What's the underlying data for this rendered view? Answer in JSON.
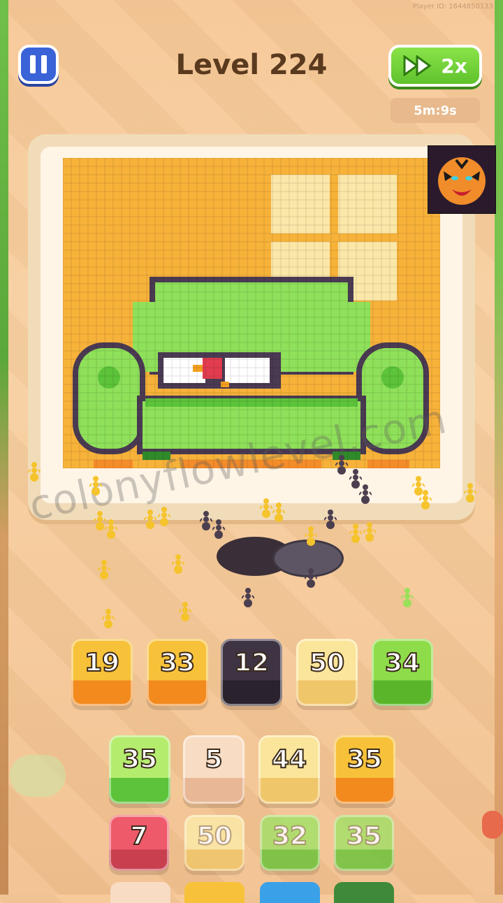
{
  "header": {
    "player_id": "Player ID: 1644850133",
    "level_title": "Level 224",
    "speed_label": "2x",
    "timer": "5m:9s"
  },
  "watermark": "colonyflowlevel.com",
  "colors": {
    "wall": "#f7b23a",
    "window": "#fbe7a8",
    "sofa_light": "#8fe05a",
    "sofa_mid": "#5cc33a",
    "sofa_dark": "#2f8a2a",
    "outline": "#4a3a52",
    "trim": "#f58c2a",
    "ant_yellow": "#f5c32c",
    "ant_dark": "#4b3f4f"
  },
  "tiles_row1": [
    {
      "value": "19",
      "top": "#f7c23a",
      "bottom": "#f28a1e"
    },
    {
      "value": "33",
      "top": "#f7c23a",
      "bottom": "#f28a1e"
    },
    {
      "value": "12",
      "top": "#3f3443",
      "bottom": "#2a222d"
    },
    {
      "value": "50",
      "top": "#fbe59a",
      "bottom": "#f0c66a"
    },
    {
      "value": "34",
      "top": "#8fdc4a",
      "bottom": "#5bb52a"
    }
  ],
  "tiles_row2": [
    {
      "value": "35",
      "top": "#b4ec6e",
      "bottom": "#5cc33a"
    },
    {
      "value": "5",
      "top": "#f8dcc3",
      "bottom": "#e8b896"
    },
    {
      "value": "44",
      "top": "#fbe59a",
      "bottom": "#f0c66a"
    },
    {
      "value": "35",
      "top": "#f7c23a",
      "bottom": "#f28a1e"
    }
  ],
  "tiles_row3": [
    {
      "value": "7",
      "top": "#ee5a6a",
      "bottom": "#c8404f"
    },
    {
      "value": "50",
      "top": "#fbe9a8",
      "bottom": "#f0c66a"
    },
    {
      "value": "32",
      "top": "#a6e06a",
      "bottom": "#6ec43c"
    },
    {
      "value": "35",
      "top": "#a6e06a",
      "bottom": "#6ec43c"
    }
  ]
}
